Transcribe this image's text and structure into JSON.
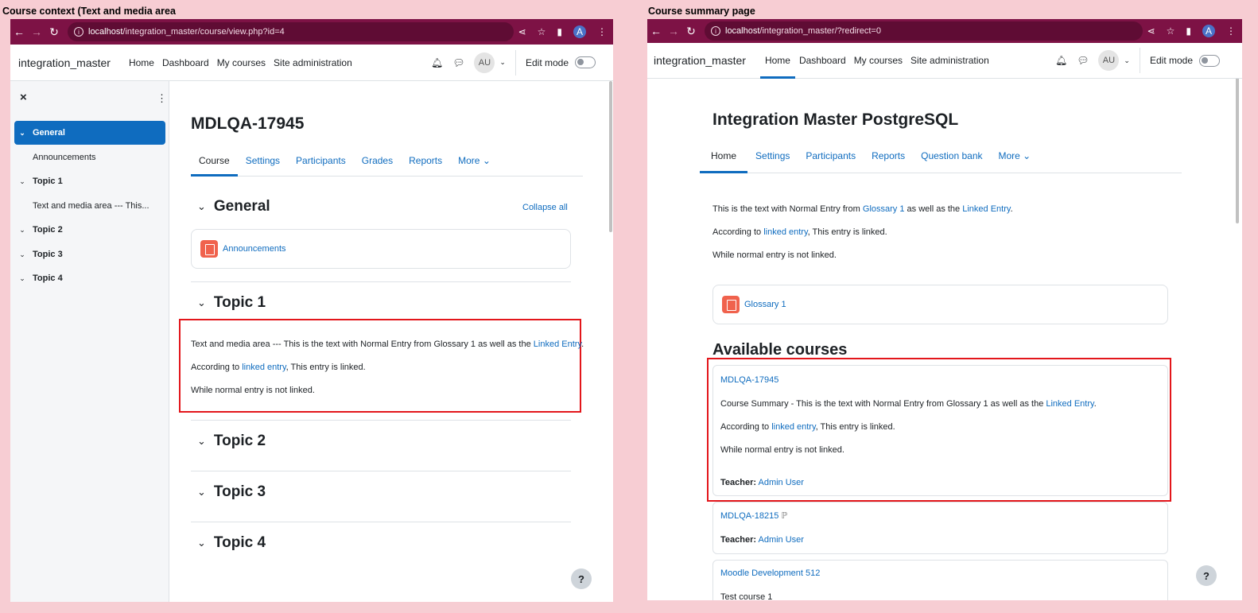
{
  "left_caption": "Course context (Text and media area",
  "right_caption": "Course summary page",
  "left": {
    "url_host": "localhost",
    "url_path": "/integration_master/course/view.php?id=4",
    "brand": "integration_master",
    "nav": [
      "Home",
      "Dashboard",
      "My courses",
      "Site administration"
    ],
    "avatar": "AU",
    "edit_mode": "Edit mode",
    "drawer": {
      "items": [
        {
          "label": "General",
          "kind": "section"
        },
        {
          "label": "Announcements",
          "kind": "activity"
        },
        {
          "label": "Topic 1",
          "kind": "section"
        },
        {
          "label": "Text and media area --- This...",
          "kind": "activity"
        },
        {
          "label": "Topic 2",
          "kind": "section"
        },
        {
          "label": "Topic 3",
          "kind": "section"
        },
        {
          "label": "Topic 4",
          "kind": "section"
        }
      ]
    },
    "course_title": "MDLQA-17945",
    "tabs": [
      "Course",
      "Settings",
      "Participants",
      "Grades",
      "Reports",
      "More ⌄"
    ],
    "sections": {
      "general": "General",
      "collapse_all": "Collapse all",
      "announcements": "Announcements",
      "topic1": "Topic 1",
      "topic2": "Topic 2",
      "topic3": "Topic 3",
      "topic4": "Topic 4"
    },
    "text_area": {
      "line1_pre": "Text and media area --- This is the text with Normal Entry from Glossary 1 as well as the ",
      "line1_link": "Linked Entry",
      "line1_post": ".",
      "line2_pre": "According to ",
      "line2_link": "linked entry",
      "line2_post": ", This entry is linked.",
      "line3": "While normal entry is not linked."
    },
    "help": "?"
  },
  "right": {
    "url_host": "localhost",
    "url_path": "/integration_master/?redirect=0",
    "brand": "integration_master",
    "nav": [
      "Home",
      "Dashboard",
      "My courses",
      "Site administration"
    ],
    "avatar": "AU",
    "edit_mode": "Edit mode",
    "site_title": "Integration Master PostgreSQL",
    "tabs": [
      "Home",
      "Settings",
      "Participants",
      "Reports",
      "Question bank",
      "More ⌄"
    ],
    "summary": {
      "line1_pre": "This is the text with Normal Entry from ",
      "line1_link1": "Glossary 1",
      "line1_mid": " as well as the ",
      "line1_link2": "Linked Entry",
      "line1_post": ".",
      "line2_pre": "According to ",
      "line2_link": "linked entry",
      "line2_post": ", This entry is linked.",
      "line3": "While normal entry is not linked."
    },
    "glossary": "Glossary 1",
    "available_courses": "Available courses",
    "courses": [
      {
        "name": "MDLQA-17945",
        "summary1_pre": "Course Summary - This is the text with Normal Entry from Glossary 1 as well as the ",
        "summary1_link": "Linked Entry",
        "summary1_post": ".",
        "summary2_pre": "According to ",
        "summary2_link": "linked entry",
        "summary2_post": ", This entry is linked.",
        "summary3": "While normal entry is not linked.",
        "teacher_label": "Teacher:",
        "teacher": "Admin User"
      },
      {
        "name": "MDLQA-18215",
        "teacher_label": "Teacher:",
        "teacher": "Admin User"
      },
      {
        "name": "Moodle Development 512",
        "summary": "Test course 1"
      }
    ],
    "help": "?"
  }
}
